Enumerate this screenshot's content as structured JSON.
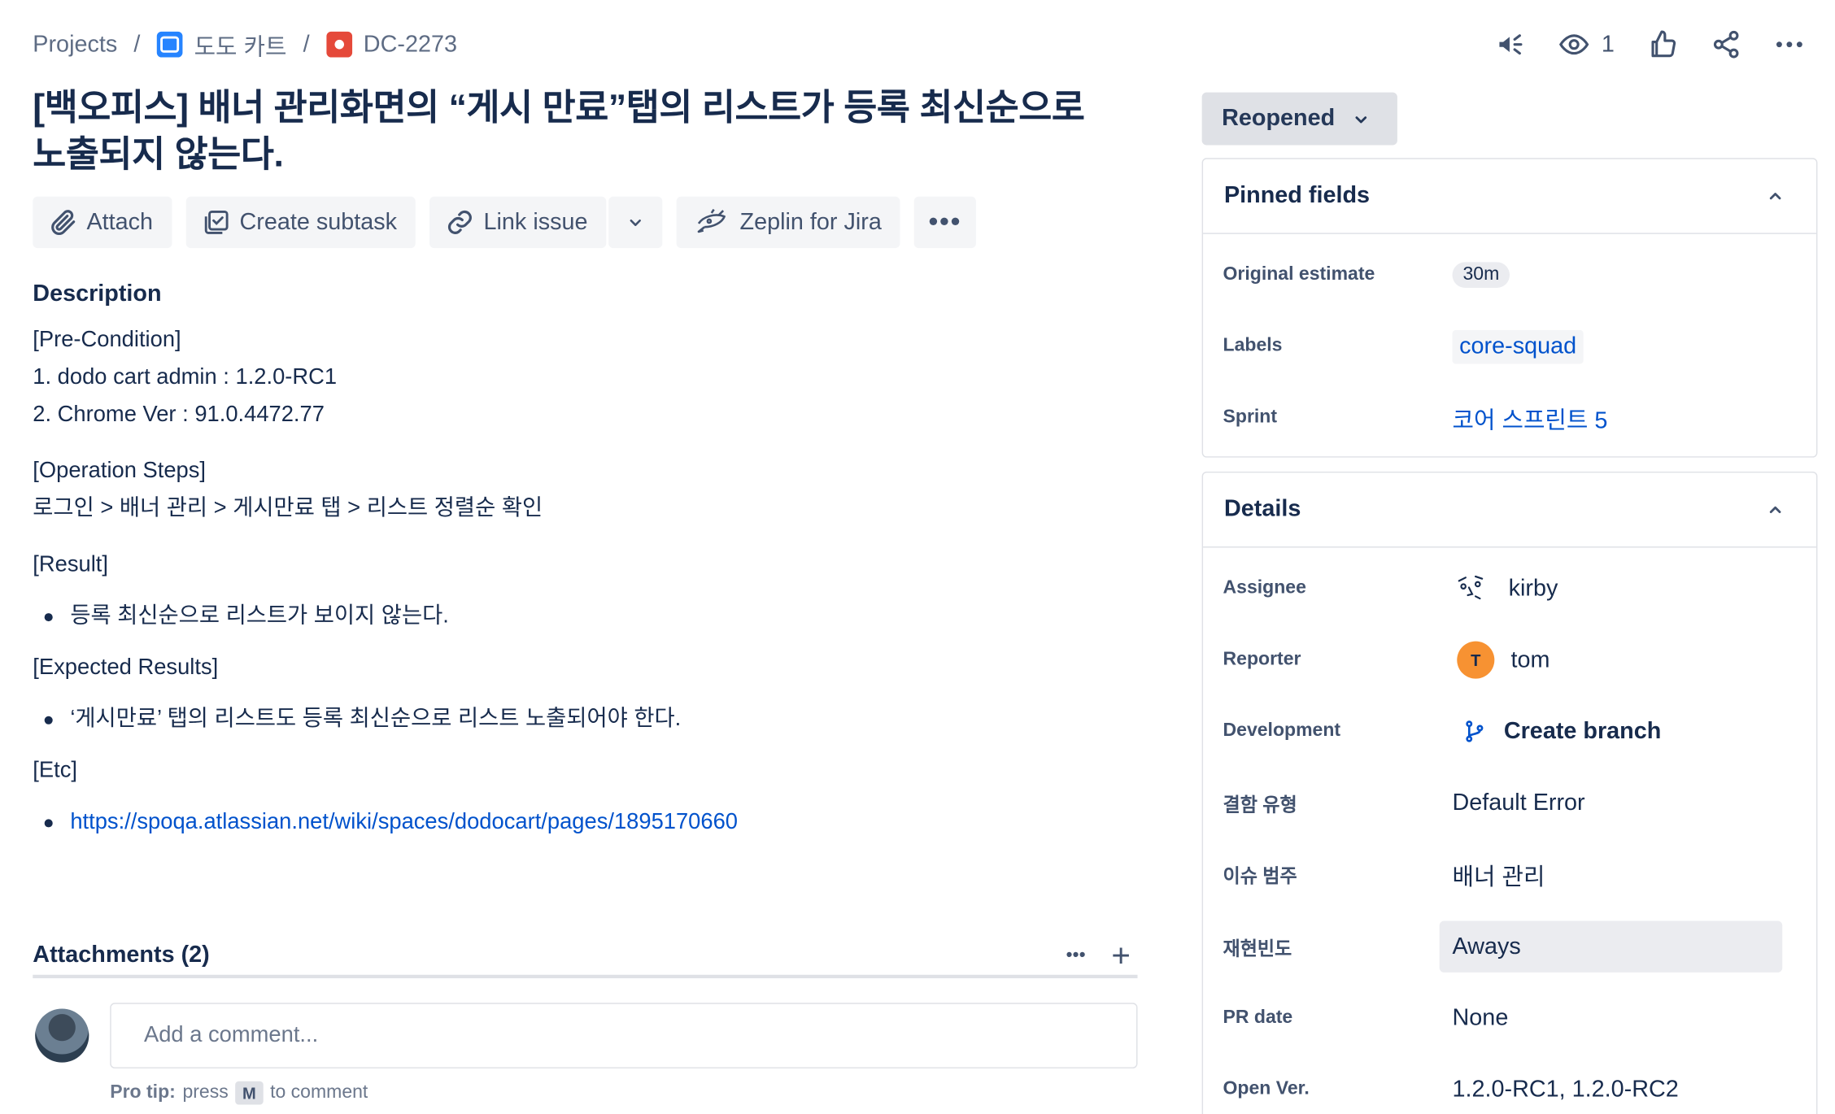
{
  "breadcrumb": {
    "projects": "Projects",
    "project_name": "도도 카트",
    "issue_key": "DC-2273",
    "separator": "/"
  },
  "top_actions": {
    "watchers_count": "1"
  },
  "issue": {
    "title": "[백오피스] 배너 관리화면의 “게시 만료”탭의 리스트가 등록 최신순으로 노출되지 않는다."
  },
  "toolbar": {
    "attach": "Attach",
    "create_subtask": "Create subtask",
    "link_issue": "Link issue",
    "zeplin": "Zeplin for Jira",
    "more": "•••"
  },
  "description": {
    "heading": "Description",
    "pre_condition": "[Pre-Condition]",
    "pre_1": "1. dodo cart admin : 1.2.0-RC1",
    "pre_2": "2. Chrome Ver : 91.0.4472.77",
    "steps_heading": "[Operation Steps]",
    "steps": "로그인 > 배너 관리 > 게시만료 탭 > 리스트 정렬순 확인",
    "result_heading": "[Result]",
    "result_item": "등록 최신순으로 리스트가 보이지 않는다.",
    "expected_heading": "[Expected Results]",
    "expected_item": "‘게시만료’ 탭의 리스트도 등록 최신순으로 리스트 노출되어야 한다.",
    "etc_heading": "[Etc]",
    "etc_link": "https://spoqa.atlassian.net/wiki/spaces/dodocart/pages/1895170660"
  },
  "attachments": {
    "label": "Attachments (2)",
    "more": "•••",
    "add": "+"
  },
  "comment": {
    "placeholder": "Add a comment...",
    "protip_label": "Pro tip:",
    "protip_press": "press",
    "protip_key": "M",
    "protip_suffix": "to comment"
  },
  "status": {
    "label": "Reopened"
  },
  "pinned": {
    "heading": "Pinned fields",
    "original_estimate_label": "Original estimate",
    "original_estimate_value": "30m",
    "labels_label": "Labels",
    "labels_value": "core-squad",
    "sprint_label": "Sprint",
    "sprint_value": "코어 스프린트 5"
  },
  "details": {
    "heading": "Details",
    "assignee_label": "Assignee",
    "assignee_value": "kirby",
    "reporter_label": "Reporter",
    "reporter_initial": "T",
    "reporter_value": "tom",
    "development_label": "Development",
    "development_value": "Create branch",
    "defect_type_label": "결함 유형",
    "defect_type_value": "Default Error",
    "issue_category_label": "이슈 범주",
    "issue_category_value": "배너 관리",
    "repro_label": "재현빈도",
    "repro_value": "Aways",
    "pr_date_label": "PR date",
    "pr_date_value": "None",
    "open_ver_label": "Open Ver.",
    "open_ver_value": "1.2.0-RC1, 1.2.0-RC2"
  },
  "colors": {
    "link": "#0052cc",
    "text": "#172b4d",
    "subtle": "#42526e",
    "status_bg": "#dfe1e6",
    "bug_icon": "#e5493a",
    "project_icon": "#2684ff",
    "reporter_avatar": "#f79232"
  }
}
